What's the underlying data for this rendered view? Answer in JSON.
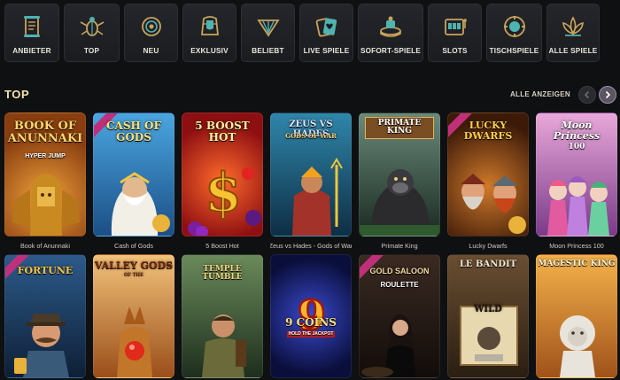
{
  "nav": {
    "categories": [
      {
        "label": "ANBIETER",
        "icon": "scroll-icon"
      },
      {
        "label": "TOP",
        "icon": "scarab-icon"
      },
      {
        "label": "NEU",
        "icon": "sun-disk-icon"
      },
      {
        "label": "EXKLUSIV",
        "icon": "pharaoh-mask-icon"
      },
      {
        "label": "BELIEBT",
        "icon": "lotus-fan-icon"
      },
      {
        "label": "LIVE SPIELE",
        "icon": "playing-cards-icon"
      },
      {
        "label": "SOFORT-SPIELE",
        "icon": "instant-game-icon"
      },
      {
        "label": "SLOTS",
        "icon": "slot-machine-icon"
      },
      {
        "label": "TISCHSPIELE",
        "icon": "poker-chip-icon"
      },
      {
        "label": "ALLE SPIELE",
        "icon": "lotus-icon"
      }
    ]
  },
  "section": {
    "title": "TOP",
    "see_all": "ALLE ANZEIGEN"
  },
  "colors": {
    "accent": "#c9a45c",
    "title": "#f3e0b0"
  },
  "games_row1": [
    {
      "name": "Book of Anunnaki",
      "thumb_title": "BOOK OF ANUNNAKI",
      "thumb_sub": "HYPER JUMP",
      "bg": "#a8581a"
    },
    {
      "name": "Cash of Gods",
      "thumb_title": "CASH OF GODS",
      "thumb_sub": "",
      "bg": "#2b7fbf"
    },
    {
      "name": "5 Boost Hot",
      "thumb_title": "5 BOOST HOT",
      "thumb_sub": "",
      "bg": "#c0241e"
    },
    {
      "name": "Zeus vs Hades - Gods of War",
      "thumb_title": "ZEUS VS HADES",
      "thumb_sub": "GODS OF WAR",
      "bg": "#1d5b7d"
    },
    {
      "name": "Primate King",
      "thumb_title": "PRIMATE KING",
      "thumb_sub": "",
      "bg": "#2f4a3c"
    },
    {
      "name": "Lucky Dwarfs",
      "thumb_title": "LUCKY DWARFS",
      "thumb_sub": "",
      "bg": "#7a3a1a"
    },
    {
      "name": "Moon Princess 100",
      "thumb_title": "Moon Princess",
      "thumb_sub": "100",
      "bg": "#b06ab0"
    }
  ],
  "games_row2": [
    {
      "name": "",
      "thumb_title": "FORTUNE",
      "thumb_sub": "",
      "bg": "#1d3f66"
    },
    {
      "name": "",
      "thumb_title": "VALLEY GODS",
      "thumb_sub": "OF THE",
      "bg": "#c77a2e"
    },
    {
      "name": "",
      "thumb_title": "TEMPLE TUMBLE",
      "thumb_sub": "",
      "bg": "#3a5a3a"
    },
    {
      "name": "",
      "thumb_title": "9 COINS",
      "thumb_sub": "HOLD THE JACKPOT",
      "bg": "#16206b"
    },
    {
      "name": "",
      "thumb_title": "GOLD SALOON",
      "thumb_sub": "ROULETTE",
      "bg": "#2b1f18"
    },
    {
      "name": "",
      "thumb_title": "LE BANDIT",
      "thumb_sub": "WILD",
      "bg": "#4a3522"
    },
    {
      "name": "",
      "thumb_title": "MAGESTIC KING",
      "thumb_sub": "",
      "bg": "#d28a2a"
    }
  ]
}
